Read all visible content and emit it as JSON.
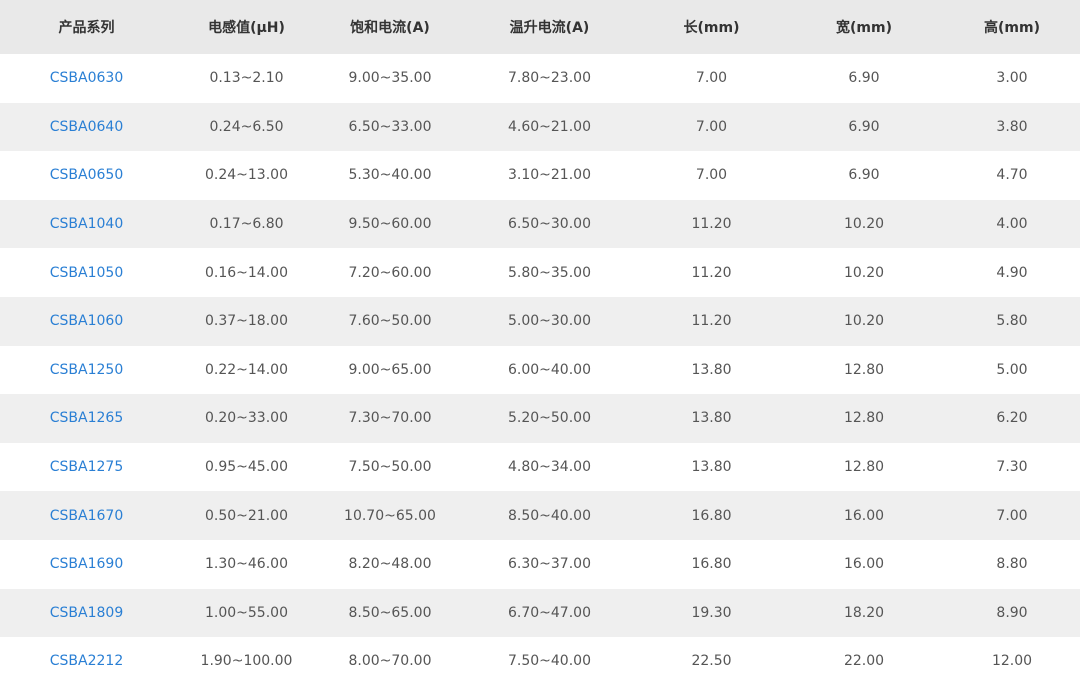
{
  "table": {
    "headers": [
      "产品系列",
      "电感值(μH)",
      "饱和电流(A)",
      "温升电流(A)",
      "长(mm)",
      "宽(mm)",
      "高(mm)"
    ],
    "rows": [
      [
        "CSBA0630",
        "0.13~2.10",
        "9.00~35.00",
        "7.80~23.00",
        "7.00",
        "6.90",
        "3.00"
      ],
      [
        "CSBA0640",
        "0.24~6.50",
        "6.50~33.00",
        "4.60~21.00",
        "7.00",
        "6.90",
        "3.80"
      ],
      [
        "CSBA0650",
        "0.24~13.00",
        "5.30~40.00",
        "3.10~21.00",
        "7.00",
        "6.90",
        "4.70"
      ],
      [
        "CSBA1040",
        "0.17~6.80",
        "9.50~60.00",
        "6.50~30.00",
        "11.20",
        "10.20",
        "4.00"
      ],
      [
        "CSBA1050",
        "0.16~14.00",
        "7.20~60.00",
        "5.80~35.00",
        "11.20",
        "10.20",
        "4.90"
      ],
      [
        "CSBA1060",
        "0.37~18.00",
        "7.60~50.00",
        "5.00~30.00",
        "11.20",
        "10.20",
        "5.80"
      ],
      [
        "CSBA1250",
        "0.22~14.00",
        "9.00~65.00",
        "6.00~40.00",
        "13.80",
        "12.80",
        "5.00"
      ],
      [
        "CSBA1265",
        "0.20~33.00",
        "7.30~70.00",
        "5.20~50.00",
        "13.80",
        "12.80",
        "6.20"
      ],
      [
        "CSBA1275",
        "0.95~45.00",
        "7.50~50.00",
        "4.80~34.00",
        "13.80",
        "12.80",
        "7.30"
      ],
      [
        "CSBA1670",
        "0.50~21.00",
        "10.70~65.00",
        "8.50~40.00",
        "16.80",
        "16.00",
        "7.00"
      ],
      [
        "CSBA1690",
        "1.30~46.00",
        "8.20~48.00",
        "6.30~37.00",
        "16.80",
        "16.00",
        "8.80"
      ],
      [
        "CSBA1809",
        "1.00~55.00",
        "8.50~65.00",
        "6.70~47.00",
        "19.30",
        "18.20",
        "8.90"
      ],
      [
        "CSBA2212",
        "1.90~100.00",
        "8.00~70.00",
        "7.50~40.00",
        "22.50",
        "22.00",
        "12.00"
      ]
    ]
  },
  "colors": {
    "header_bg": "#e9e9e9",
    "stripe_bg": "#efefef",
    "link": "#2a7fd4",
    "text": "#555555"
  }
}
